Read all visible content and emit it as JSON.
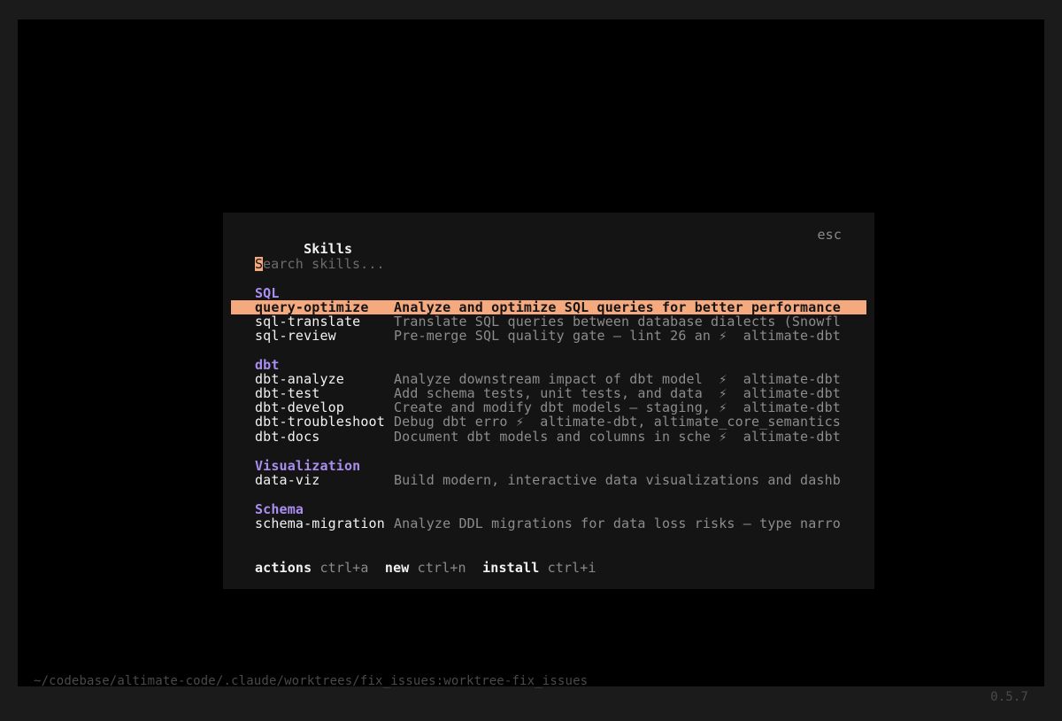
{
  "dialog": {
    "title": "Skills",
    "close_hint": "esc",
    "search": {
      "cursor_char": "S",
      "placeholder_rest": "earch skills..."
    },
    "groups": [
      {
        "label": "SQL",
        "items": [
          {
            "name": "query-optimize",
            "description": "Analyze and optimize SQL queries for better performance",
            "selected": true
          },
          {
            "name": "sql-translate",
            "description": "Translate SQL queries between database dialects (Snowfl"
          },
          {
            "name": "sql-review",
            "description": "Pre-merge SQL quality gate — lint 26 an ⚡  altimate-dbt"
          }
        ]
      },
      {
        "label": "dbt",
        "items": [
          {
            "name": "dbt-analyze",
            "description": "Analyze downstream impact of dbt model  ⚡  altimate-dbt"
          },
          {
            "name": "dbt-test",
            "description": "Add schema tests, unit tests, and data  ⚡  altimate-dbt"
          },
          {
            "name": "dbt-develop",
            "description": "Create and modify dbt models — staging, ⚡  altimate-dbt"
          },
          {
            "name": "dbt-troubleshoot",
            "description": "Debug dbt erro ⚡  altimate-dbt, altimate_core_semantics"
          },
          {
            "name": "dbt-docs",
            "description": "Document dbt models and columns in sche ⚡  altimate-dbt"
          }
        ]
      },
      {
        "label": "Visualization",
        "items": [
          {
            "name": "data-viz",
            "description": "Build modern, interactive data visualizations and dashb"
          }
        ]
      },
      {
        "label": "Schema",
        "items": [
          {
            "name": "schema-migration",
            "description": "Analyze DDL migrations for data loss risks — type narro"
          }
        ]
      }
    ],
    "footer": [
      {
        "label": "actions",
        "shortcut": "ctrl+a"
      },
      {
        "label": "new",
        "shortcut": "ctrl+n"
      },
      {
        "label": "install",
        "shortcut": "ctrl+i"
      }
    ]
  },
  "statusbar": {
    "path": "~/codebase/altimate-code/.claude/worktrees/fix_issues:worktree-fix_issues",
    "version": "0.5.7"
  },
  "colors": {
    "accent": "#f5a97f",
    "group_heading": "#a98ef0",
    "background": "#000000",
    "dialog_background": "#141414"
  }
}
